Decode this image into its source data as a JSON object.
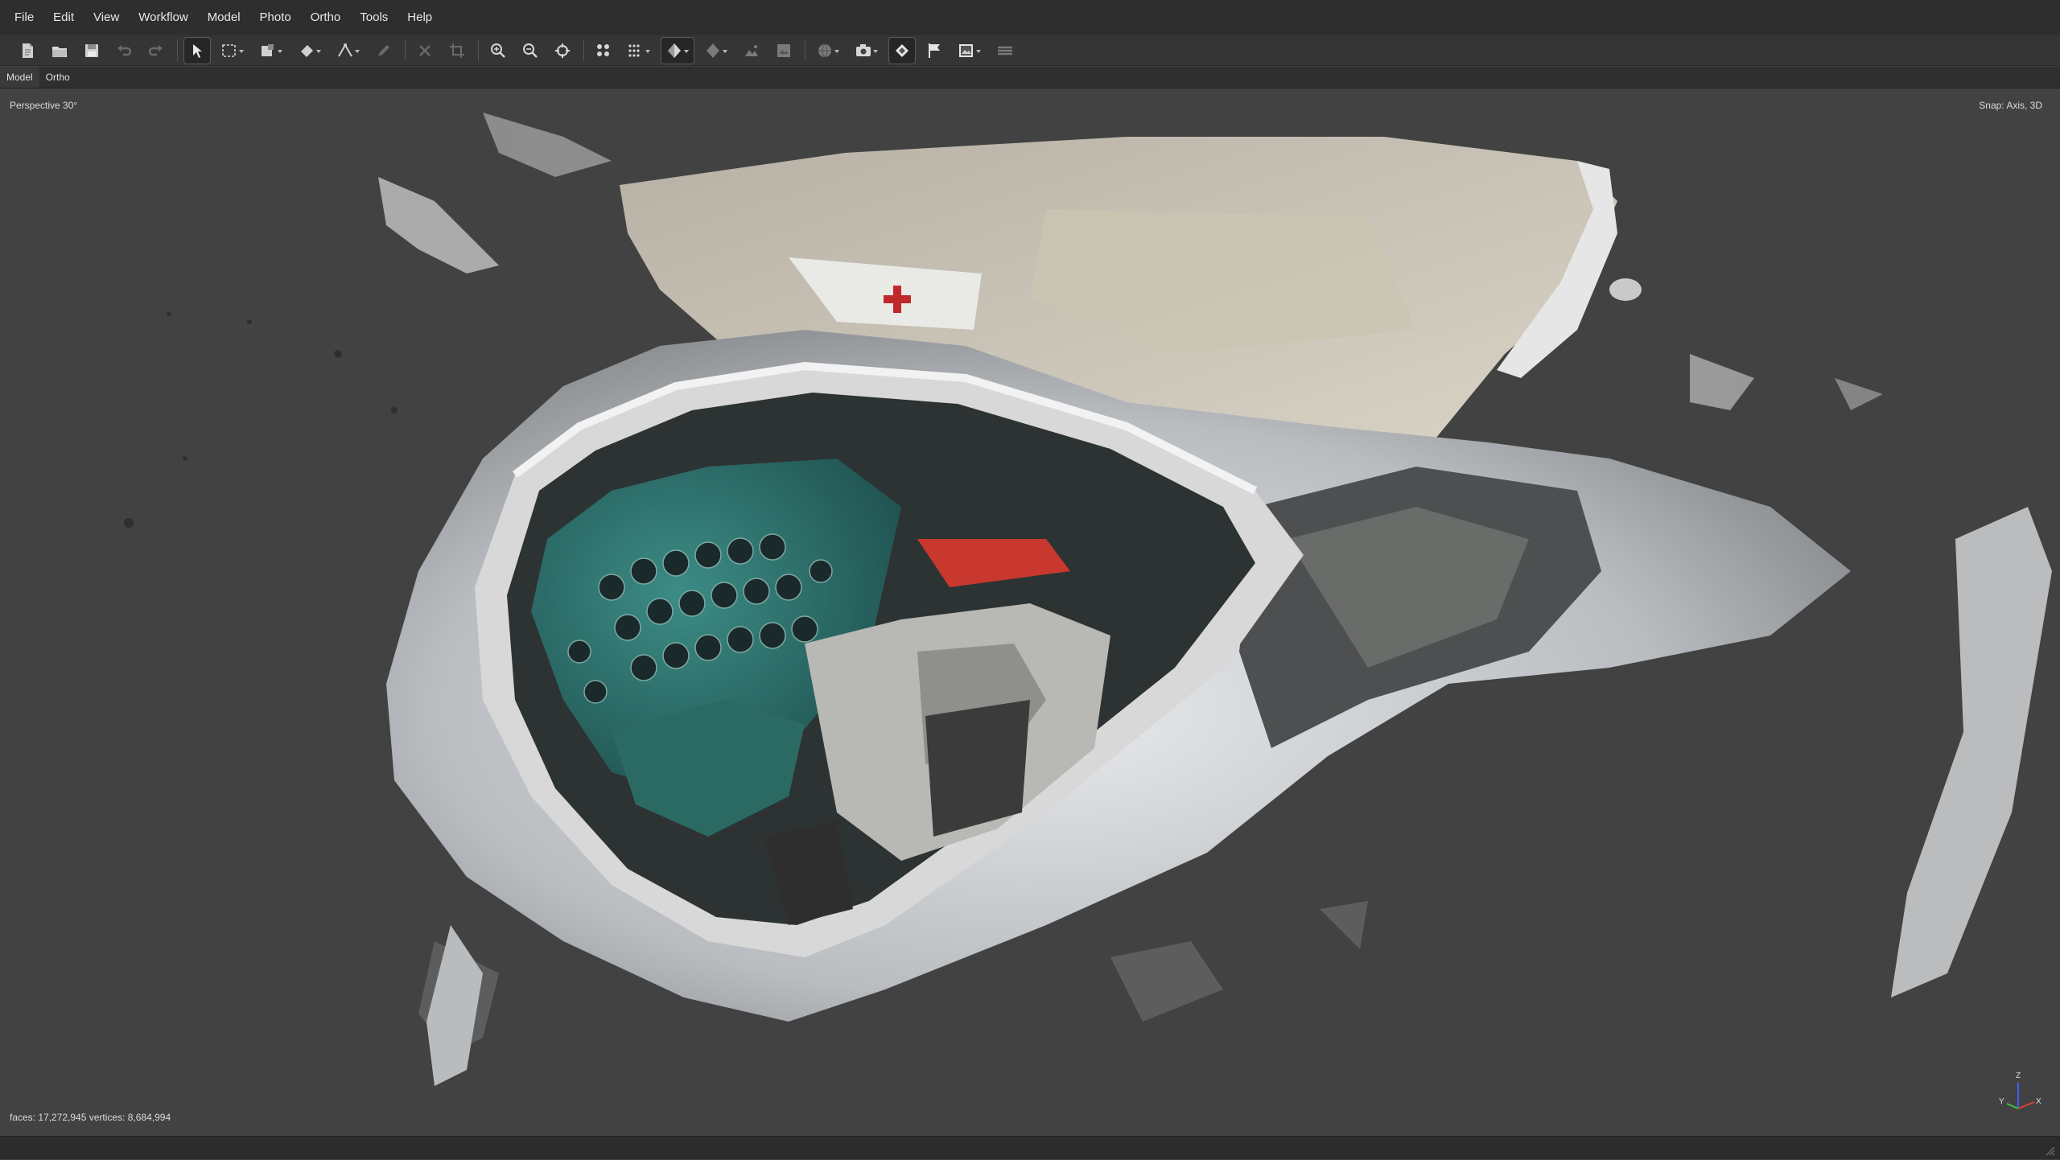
{
  "menu": {
    "items": [
      "File",
      "Edit",
      "View",
      "Workflow",
      "Model",
      "Photo",
      "Ortho",
      "Tools",
      "Help"
    ]
  },
  "toolbar": {
    "buttons": [
      {
        "name": "new-document-icon"
      },
      {
        "name": "open-folder-icon"
      },
      {
        "name": "save-icon"
      },
      {
        "name": "undo-icon"
      },
      {
        "name": "redo-icon"
      },
      {
        "name": "navigation-cursor-icon"
      },
      {
        "name": "rectangle-selection-icon"
      },
      {
        "name": "resize-region-icon"
      },
      {
        "name": "rotate-object-icon"
      },
      {
        "name": "ruler-icon"
      },
      {
        "name": "draw-tool-icon"
      },
      {
        "name": "delete-selection-icon"
      },
      {
        "name": "crop-selection-icon"
      },
      {
        "name": "zoom-in-icon"
      },
      {
        "name": "zoom-out-icon"
      },
      {
        "name": "reset-view-icon"
      },
      {
        "name": "point-cloud-icon"
      },
      {
        "name": "dense-cloud-icon"
      },
      {
        "name": "model-shaded-icon"
      },
      {
        "name": "tiled-model-icon"
      },
      {
        "name": "dem-icon"
      },
      {
        "name": "orthomosaic-icon"
      },
      {
        "name": "globe-icon"
      },
      {
        "name": "camera-icon"
      },
      {
        "name": "show-markers-icon"
      },
      {
        "name": "show-flags-icon"
      },
      {
        "name": "show-images-icon"
      },
      {
        "name": "show-layers-icon"
      }
    ]
  },
  "tabs": [
    "Model",
    "Ortho"
  ],
  "viewport": {
    "projection_label": "Perspective 30°",
    "snap_label": "Snap: Axis, 3D",
    "stats_label": "faces: 17,272,945 vertices: 8,684,994",
    "axis_labels": {
      "x": "X",
      "y": "Y",
      "z": "Z"
    }
  },
  "colors": {
    "background": "#424242",
    "menubar": "#2e2e2e",
    "toolbar": "#353535",
    "axis_x": "#e04040",
    "axis_y": "#40c040",
    "axis_z": "#4060ff"
  }
}
